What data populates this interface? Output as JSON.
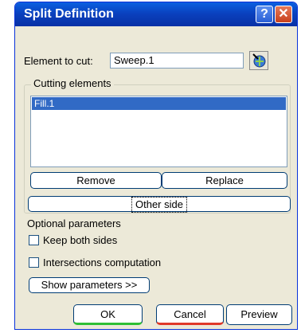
{
  "window": {
    "title": "Split Definition"
  },
  "element_to_cut": {
    "label": "Element to cut:",
    "value": "Sweep.1"
  },
  "cutting_elements": {
    "group_label": "Cutting elements",
    "items": [
      "Fill.1"
    ]
  },
  "buttons": {
    "remove": "Remove",
    "replace": "Replace",
    "other_side": "Other side",
    "show_parameters": "Show parameters >>",
    "ok": "OK",
    "cancel": "Cancel",
    "preview": "Preview"
  },
  "optional": {
    "label": "Optional parameters",
    "keep_both_sides": "Keep both sides",
    "intersections": "Intersections computation"
  },
  "colors": {
    "title_bar": "#0a5fe0",
    "selection": "#316ac5",
    "ok_accent": "#2fbf35",
    "cancel_accent": "#e0392a"
  }
}
